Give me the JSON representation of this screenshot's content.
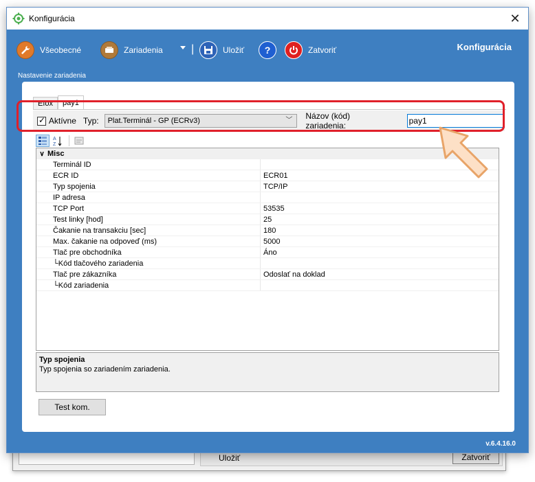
{
  "background_window": {
    "label": "Uložiť",
    "button": "Zatvoriť"
  },
  "window": {
    "title": "Konfigurácia",
    "heading": "Konfigurácia",
    "subtitle": "Nastavenie zariadenia",
    "version": "v.6.4.16.0"
  },
  "toolbar": {
    "general": "Všeobecné",
    "devices": "Zariadenia",
    "save": "Uložiť",
    "help": "?",
    "close": "Zatvoriť"
  },
  "tabs": [
    "Efox",
    "pay1"
  ],
  "settings": {
    "active_label": "Aktívne",
    "active_checked": true,
    "type_label": "Typ:",
    "type_value": "Plat.Terminál - GP (ECRv3)",
    "name_label": "Názov (kód) zariadenia:",
    "name_value": "pay1"
  },
  "grid": {
    "category": "Misc",
    "rows": [
      {
        "key": "Terminál ID",
        "value": ""
      },
      {
        "key": "ECR ID",
        "value": "ECR01"
      },
      {
        "key": "Typ spojenia",
        "value": "TCP/IP"
      },
      {
        "key": "IP adresa",
        "value": ""
      },
      {
        "key": "TCP Port",
        "value": "53535"
      },
      {
        "key": "Test linky [hod]",
        "value": "25"
      },
      {
        "key": "Čakanie na transakciu [sec]",
        "value": "180"
      },
      {
        "key": "Max. čakanie na odpoveď (ms)",
        "value": "5000"
      },
      {
        "key": "Tlač pre obchodníka",
        "value": "Áno"
      },
      {
        "key": "└Kód tlačového zariadenia",
        "value": ""
      },
      {
        "key": "Tlač pre zákazníka",
        "value": "Odoslať na doklad"
      },
      {
        "key": "└Kód zariadenia",
        "value": ""
      }
    ]
  },
  "description": {
    "title": "Typ spojenia",
    "text": "Typ spojenia so zariadením zariadenia."
  },
  "test_button": "Test kom.",
  "colors": {
    "accent": "#3e7fc1",
    "highlight": "#e0202a",
    "pointer": "#f7c8a0"
  }
}
